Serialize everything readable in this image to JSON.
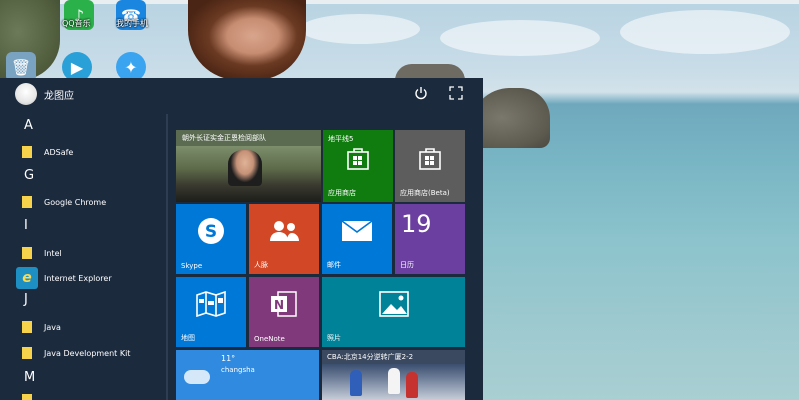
{
  "desktop": {
    "icons": [
      {
        "label": "QQ音乐",
        "icon": "qq-music-icon"
      },
      {
        "label": "我的手机",
        "icon": "phone-icon"
      }
    ]
  },
  "start_menu": {
    "user_name": "龙图应",
    "power_icon": "power-icon",
    "expand_icon": "expand-icon",
    "apps": [
      {
        "letter": "A"
      },
      {
        "label": "ADSafe",
        "icon": "folder-icon"
      },
      {
        "letter": "G"
      },
      {
        "label": "Google Chrome",
        "icon": "folder-icon"
      },
      {
        "letter": "I"
      },
      {
        "label": "Intel",
        "icon": "folder-icon"
      },
      {
        "label": "Internet Explorer",
        "icon": "ie-icon"
      },
      {
        "letter": "J"
      },
      {
        "label": "Java",
        "icon": "folder-icon"
      },
      {
        "label": "Java Development Kit",
        "icon": "folder-icon"
      },
      {
        "letter": "M"
      }
    ],
    "tiles": {
      "news": {
        "caption": "朝外长证实金正恩检阅部队"
      },
      "store_win": {
        "top": "地平线5",
        "label": "应用商店"
      },
      "store_beta": {
        "label": "应用商店(Beta)"
      },
      "skype": {
        "label": "Skype"
      },
      "people": {
        "label": "人脉"
      },
      "mail": {
        "label": "邮件"
      },
      "calendar": {
        "day": "19",
        "label": "日历"
      },
      "maps": {
        "label": "地图"
      },
      "onenote": {
        "label": "OneNote"
      },
      "photos": {
        "label": "照片"
      },
      "weather": {
        "temp": "11°",
        "city": "changsha"
      },
      "sports": {
        "caption": "CBA:北京14分逆转广厦2-2"
      }
    }
  },
  "colors": {
    "menu_bg": "#1c2a3e",
    "tile_blue": "#0078d7",
    "tile_green": "#107c10",
    "tile_gray": "#5d5d5d",
    "tile_orange": "#d24726",
    "tile_purple": "#6b3fa0",
    "tile_onenote": "#80397b",
    "tile_teal": "#008299"
  }
}
